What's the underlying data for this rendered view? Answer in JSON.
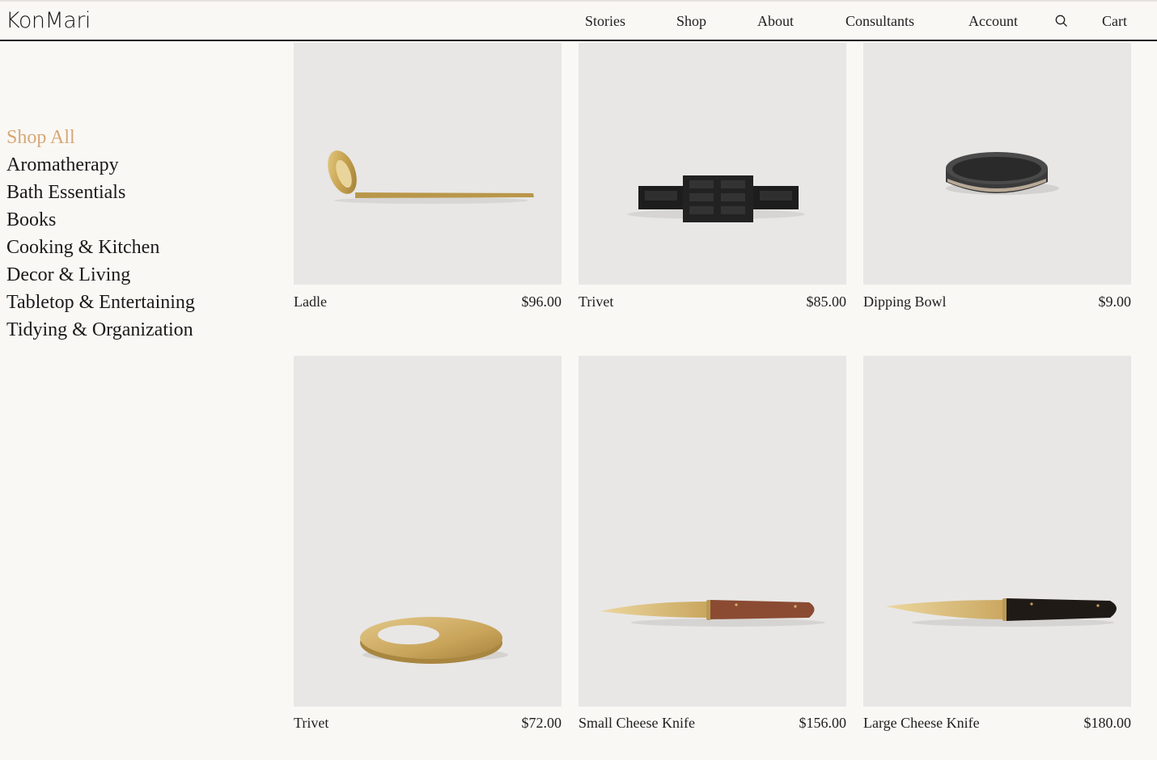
{
  "header": {
    "logo": "KonMari",
    "nav": [
      {
        "label": "Stories"
      },
      {
        "label": "Shop"
      },
      {
        "label": "About"
      },
      {
        "label": "Consultants"
      },
      {
        "label": "Account"
      }
    ],
    "search_icon": "search-icon",
    "cart_label": "Cart"
  },
  "sidebar": {
    "items": [
      {
        "label": "Shop All",
        "active": true
      },
      {
        "label": "Aromatherapy"
      },
      {
        "label": "Bath Essentials"
      },
      {
        "label": "Books"
      },
      {
        "label": "Cooking & Kitchen"
      },
      {
        "label": "Decor & Living"
      },
      {
        "label": "Tabletop & Entertaining"
      },
      {
        "label": "Tidying & Organization"
      }
    ],
    "active_color": "#d6a876"
  },
  "products": [
    {
      "name": "Ladle",
      "price": "$96.00",
      "image": "brass-ladle"
    },
    {
      "name": "Trivet",
      "price": "$85.00",
      "image": "black-iron-trivet"
    },
    {
      "name": "Dipping Bowl",
      "price": "$9.00",
      "image": "dark-ceramic-bowl"
    },
    {
      "name": "Trivet",
      "price": "$72.00",
      "image": "brass-ring-trivet"
    },
    {
      "name": "Small Cheese Knife",
      "price": "$156.00",
      "image": "knife-wood-handle"
    },
    {
      "name": "Large Cheese Knife",
      "price": "$180.00",
      "image": "knife-black-handle"
    }
  ],
  "colors": {
    "background": "#faf8f5",
    "image_bg": "#e8e7e6",
    "text": "#1e1e1e",
    "accent": "#d6a876"
  }
}
